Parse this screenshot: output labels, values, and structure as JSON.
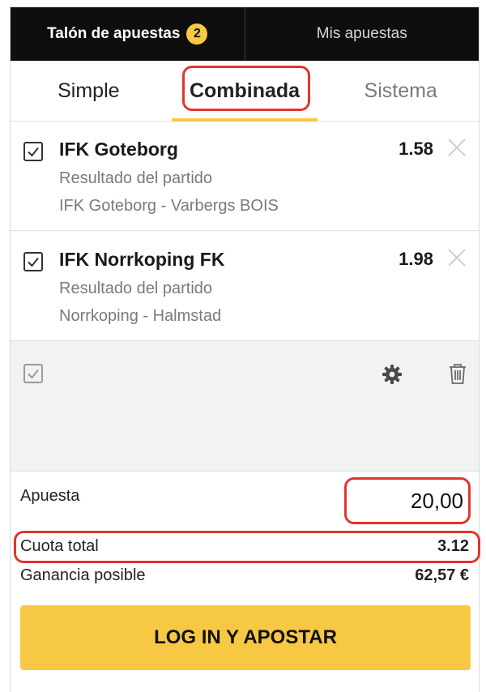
{
  "header": {
    "betslip_label": "Talón de apuestas",
    "badge_count": "2",
    "mybets_label": "Mis apuestas"
  },
  "tabs": [
    {
      "label": "Simple"
    },
    {
      "label": "Combinada"
    },
    {
      "label": "Sistema"
    }
  ],
  "selections": [
    {
      "team": "IFK Goteborg",
      "market": "Resultado del partido",
      "event": "IFK Goteborg - Varbergs BOIS",
      "odds": "1.58"
    },
    {
      "team": "IFK Norrkoping FK",
      "market": "Resultado del partido",
      "event": "Norrkoping - Halmstad",
      "odds": "1.98"
    }
  ],
  "summary": {
    "stake_label": "Apuesta",
    "stake_value": "20,00",
    "total_odds_label": "Cuota total",
    "total_odds_value": "3.12",
    "potential_win_label": "Ganancia posible",
    "potential_win_value": "62,57 €"
  },
  "cta_label": "LOG IN Y APOSTAR",
  "colors": {
    "accent": "#f6c844",
    "highlight": "#e0362c",
    "header_bg": "#0e0e0e"
  },
  "icons": [
    "check-icon",
    "close-icon",
    "gear-icon",
    "trash-icon"
  ]
}
